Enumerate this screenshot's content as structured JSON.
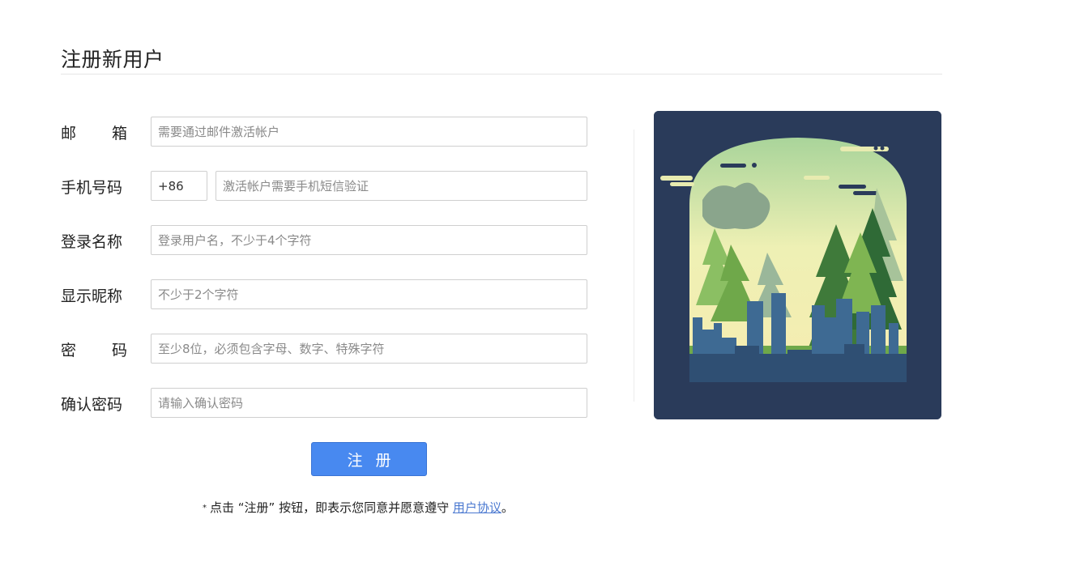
{
  "page": {
    "title": "注册新用户"
  },
  "form": {
    "email": {
      "label": "邮箱",
      "placeholder": "需要通过邮件激活帐户"
    },
    "phone": {
      "label": "手机号码",
      "country_code": "+86",
      "placeholder": "激活帐户需要手机短信验证"
    },
    "login_name": {
      "label": "登录名称",
      "placeholder": "登录用户名，不少于4个字符"
    },
    "display_name": {
      "label": "显示昵称",
      "placeholder": "不少于2个字符"
    },
    "password": {
      "label": "密码",
      "placeholder": "至少8位，必须包含字母、数字、特殊字符"
    },
    "confirm_password": {
      "label": "确认密码",
      "placeholder": "请输入确认密码"
    }
  },
  "submit": {
    "label": "注册"
  },
  "agreement": {
    "star": "*",
    "text": "点击 “注册” 按钮，即表示您同意并愿意遵守",
    "link_text": "用户协议",
    "end": "。"
  },
  "labels_split": {
    "email": [
      "邮",
      "箱"
    ],
    "password": [
      "密",
      "码"
    ]
  },
  "colors": {
    "accent": "#4889f0",
    "link": "#4a78d0",
    "illustration_bg": "#2a3b5a"
  }
}
